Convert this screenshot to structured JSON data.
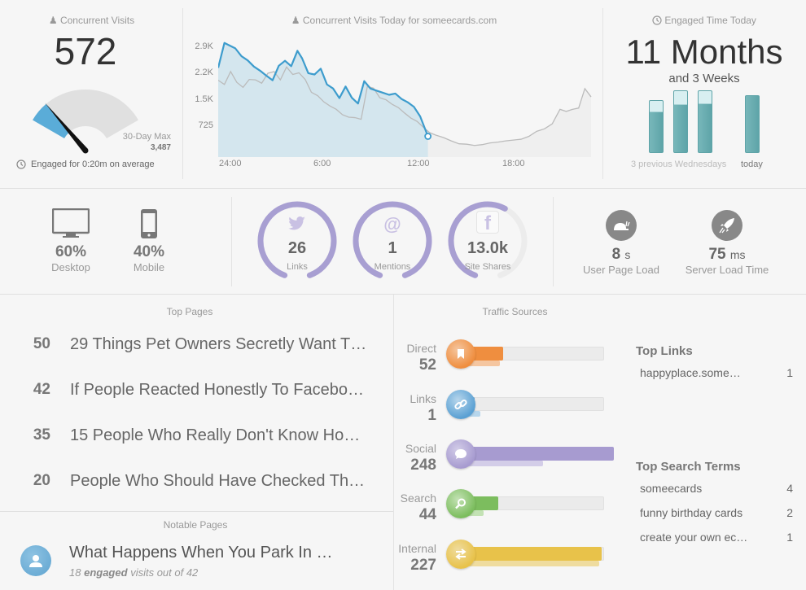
{
  "concurrent_visits": {
    "title": "Concurrent Visits",
    "value": "572",
    "max_label": "30-Day Max",
    "max_value": "3,487",
    "gauge_fraction": 0.164,
    "engaged_text": "Engaged for 0:20m on average",
    "colors": {
      "fill": "#5aacd8",
      "track": "#e0e0e0"
    }
  },
  "chart_data": {
    "type": "line",
    "title": "Concurrent Visits Today for someecards.com",
    "xlabel": "",
    "ylabel": "",
    "x_ticks": [
      "24:00",
      "6:00",
      "12:00",
      "18:00"
    ],
    "x_range_hours": [
      0,
      24
    ],
    "y_ticks": [
      "2.9K",
      "2.2K",
      "1.5K",
      "725"
    ],
    "y_tick_values": [
      2900,
      2200,
      1500,
      725
    ],
    "ylim": [
      0,
      3000
    ],
    "series": [
      {
        "name": "today",
        "color": "#3d9ccd",
        "x": [
          0,
          0.4,
          1.1,
          1.5,
          1.9,
          2.3,
          2.7,
          3.1,
          3.5,
          3.9,
          4.3,
          4.7,
          5.1,
          5.4,
          5.8,
          6.2,
          6.6,
          7.0,
          7.4,
          7.8,
          8.2,
          8.6,
          9.0,
          9.4,
          9.8,
          10.2,
          10.6,
          11.0,
          11.4,
          11.8,
          12.2,
          12.6,
          13.0,
          13.5
        ],
        "values": [
          2150,
          2750,
          2620,
          2430,
          2330,
          2180,
          2080,
          1960,
          1850,
          2200,
          2320,
          2190,
          2560,
          2380,
          2020,
          1990,
          2130,
          1750,
          1650,
          1420,
          1700,
          1430,
          1290,
          1830,
          1650,
          1600,
          1550,
          1500,
          1530,
          1400,
          1320,
          1210,
          980,
          500
        ]
      },
      {
        "name": "previous",
        "color": "#bbbbbb",
        "x": [
          0,
          0.4,
          0.8,
          1.2,
          1.6,
          2.0,
          2.4,
          2.8,
          3.2,
          3.6,
          4.0,
          4.4,
          4.8,
          5.2,
          5.6,
          6.0,
          6.4,
          6.8,
          7.2,
          7.6,
          8.0,
          8.4,
          8.8,
          9.2,
          9.6,
          10.0,
          10.4,
          10.8,
          11.2,
          11.6,
          12.0,
          12.4,
          12.8,
          13.2,
          13.6,
          14.0,
          14.5,
          15.0,
          15.5,
          16.0,
          16.5,
          17.0,
          17.5,
          18.0,
          18.5,
          19.0,
          19.5,
          20.0,
          20.5,
          21.0,
          21.5,
          22.0,
          22.4,
          22.8,
          23.2,
          23.6,
          24.0
        ],
        "values": [
          1850,
          1750,
          2060,
          1800,
          1680,
          1870,
          1860,
          1780,
          2020,
          2060,
          1860,
          2170,
          1990,
          2030,
          1870,
          1560,
          1480,
          1330,
          1230,
          1150,
          1020,
          960,
          950,
          910,
          1700,
          1660,
          1430,
          1380,
          1270,
          1190,
          1060,
          940,
          860,
          720,
          590,
          530,
          470,
          390,
          320,
          310,
          280,
          300,
          340,
          360,
          390,
          410,
          430,
          500,
          620,
          680,
          800,
          1150,
          1100,
          1150,
          1180,
          1650,
          1450
        ]
      }
    ],
    "current_point": {
      "x": 13.5,
      "value": 500
    },
    "grid": false,
    "legend": "none"
  },
  "engaged_time": {
    "title": "Engaged Time Today",
    "big": "11 Months",
    "sub": "and 3 Weeks",
    "bars": [
      {
        "label": "prev1",
        "total": 0.67,
        "engaged": 0.52
      },
      {
        "label": "prev2",
        "total": 0.79,
        "engaged": 0.62
      },
      {
        "label": "prev3",
        "total": 0.79,
        "engaged": 0.63
      },
      {
        "label": "today",
        "total": 0.73,
        "engaged": 0.73
      }
    ],
    "prev_label": "3 previous Wednesdays",
    "today_label": "today"
  },
  "devices": [
    {
      "icon": "desktop-icon",
      "pct": "60%",
      "label": "Desktop"
    },
    {
      "icon": "mobile-icon",
      "pct": "40%",
      "label": "Mobile"
    }
  ],
  "social": [
    {
      "icon": "twitter-icon",
      "value": "26",
      "label": "Links",
      "fraction": 0.85
    },
    {
      "icon": "at-icon",
      "value": "1",
      "label": "Mentions",
      "fraction": 0.85
    },
    {
      "icon": "facebook-icon",
      "value": "13.0k",
      "label": "Site Shares",
      "fraction": 0.5
    }
  ],
  "performance": [
    {
      "icon": "snail-icon",
      "value": "8",
      "unit": "s",
      "label": "User Page Load"
    },
    {
      "icon": "rocket-icon",
      "value": "75",
      "unit": "ms",
      "label": "Server Load Time"
    }
  ],
  "top_pages": {
    "title": "Top Pages",
    "items": [
      {
        "count": "50",
        "title": "29 Things Pet Owners Secretly Want T…"
      },
      {
        "count": "42",
        "title": "If People Reacted Honestly To Facebo…"
      },
      {
        "count": "35",
        "title": "15 People Who Really Don't Know Ho…"
      },
      {
        "count": "20",
        "title": "People Who Should Have Checked Th…"
      }
    ]
  },
  "notable_pages": {
    "title": "Notable Pages",
    "headline": "What Happens When You Park In …",
    "sub_count": "18",
    "sub_bold": "engaged",
    "sub_rest": "visits out of 42"
  },
  "traffic_sources": {
    "title": "Traffic Sources",
    "max": 260,
    "items": [
      {
        "label": "Direct",
        "value": "52",
        "num": 52,
        "ghost": 44,
        "color": "#ef8e3f",
        "light": "#f5c6a0",
        "icon": "bookmark-icon"
      },
      {
        "label": "Links",
        "value": "1",
        "num": 1,
        "ghost": 8,
        "color": "#5aa0d3",
        "light": "#b7d6ec",
        "icon": "link-icon"
      },
      {
        "label": "Social",
        "value": "248",
        "num": 248,
        "ghost": 120,
        "color": "#a79bd0",
        "light": "#d3cde8",
        "icon": "chat-icon"
      },
      {
        "label": "Search",
        "value": "44",
        "num": 44,
        "ghost": 14,
        "color": "#7cbd5e",
        "light": "#c3e2b4",
        "icon": "search-icon"
      },
      {
        "label": "Internal",
        "value": "227",
        "num": 227,
        "ghost": 220,
        "color": "#e8c24a",
        "light": "#efdc9f",
        "icon": "swap-icon"
      }
    ]
  },
  "top_links": {
    "title": "Top Links",
    "items": [
      {
        "text": "happyplace.some…",
        "count": "1"
      }
    ]
  },
  "top_search_terms": {
    "title": "Top Search Terms",
    "items": [
      {
        "text": "someecards",
        "count": "4"
      },
      {
        "text": "funny birthday cards",
        "count": "2"
      },
      {
        "text": "create your own ec…",
        "count": "1"
      }
    ]
  }
}
